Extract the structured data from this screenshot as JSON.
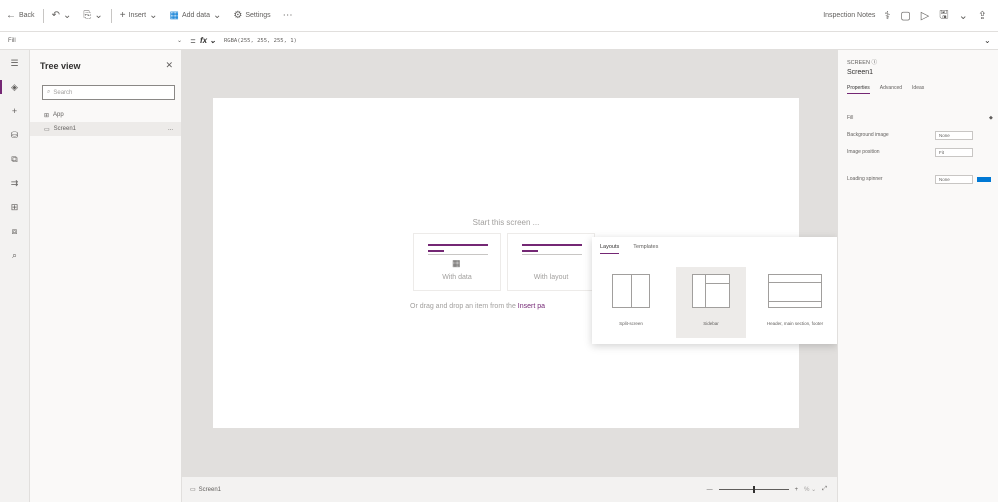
{
  "toolbar": {
    "back": "Back",
    "insert": "Insert",
    "add_data": "Add data",
    "settings": "Settings",
    "app_name": "Inspection Notes"
  },
  "formula_bar": {
    "property": "Fill",
    "formula": "RGBA(255, 255, 255, 1)"
  },
  "tree_view": {
    "title": "Tree view",
    "search_placeholder": "Search",
    "nodes": [
      {
        "label": "App"
      },
      {
        "label": "Screen1",
        "more": "..."
      }
    ]
  },
  "canvas": {
    "start_text": "Start this screen ...",
    "cards": [
      {
        "label": "With data"
      },
      {
        "label": "With layout"
      }
    ],
    "drag_text_prefix": "Or drag and drop an item from the ",
    "drag_text_link": "Insert pa"
  },
  "layout_popup": {
    "tabs": [
      "Layouts",
      "Templates"
    ],
    "options": [
      {
        "label": "Split-screen"
      },
      {
        "label": "Sidebar"
      },
      {
        "label": "Header, main section, footer"
      }
    ]
  },
  "status_bar": {
    "screen_label": "Screen1",
    "zoom_level": 0.5
  },
  "properties": {
    "kind": "Screen",
    "name": "Screen1",
    "tabs": [
      "Properties",
      "Advanced",
      "Ideas"
    ],
    "rows": [
      {
        "label": "Fill",
        "value": ""
      },
      {
        "label": "Background image",
        "value": "None"
      },
      {
        "label": "Image position",
        "value": "Fit"
      },
      {
        "label": "Loading spinner",
        "value": "None"
      }
    ]
  }
}
